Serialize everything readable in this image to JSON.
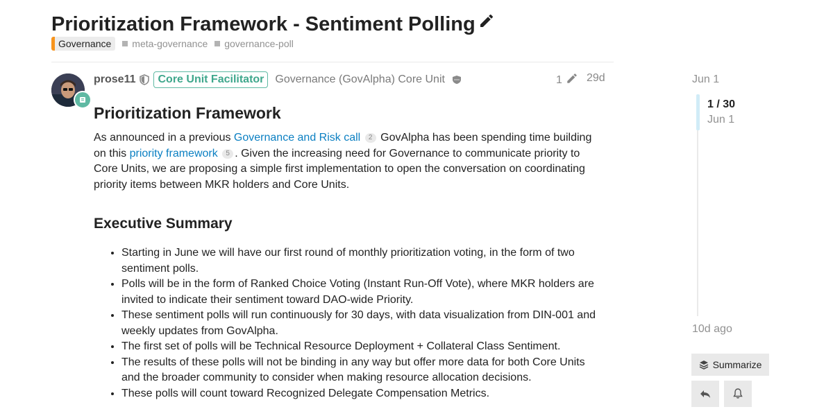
{
  "topic": {
    "title": "Prioritization Framework - Sentiment Polling",
    "category": {
      "name": "Governance",
      "color": "#f7941d"
    },
    "tags": [
      "meta-governance",
      "governance-poll"
    ]
  },
  "post": {
    "username": "prose11",
    "user_title": "Core Unit Facilitator",
    "organization": "Governance (GovAlpha) Core Unit",
    "edit_count": "1",
    "age": "29d",
    "heading": "Prioritization Framework",
    "intro": {
      "part1": "As announced in a previous ",
      "link1_text": "Governance and Risk call",
      "link1_count": "2",
      "part2": " GovAlpha has been spending time building on this ",
      "link2_text": "priority framework",
      "link2_count": "5",
      "part3": ". Given the increasing need for Governance to communicate priority to Core Units, we are proposing a simple first implementation to open the conversation on coordinating priority items between MKR holders and Core Units."
    },
    "section_heading": "Executive Summary",
    "bullets": [
      "Starting in June we will have our first round of monthly prioritization voting, in the form of two sentiment polls.",
      "Polls will be in the form of Ranked Choice Voting (Instant Run-Off Vote), where MKR holders are invited to indicate their sentiment toward DAO-wide Priority.",
      "These sentiment polls will run continuously for 30 days, with data visualization from DIN-001 and weekly updates from GovAlpha.",
      "The first set of polls will be Technical Resource Deployment + Collateral Class Sentiment.",
      "The results of these polls will not be binding in any way but offer more data for both Core Units and the broader community to consider when making resource allocation decisions.",
      "These polls will count toward Recognized Delegate Compensation Metrics."
    ]
  },
  "timeline": {
    "start_date": "Jun 1",
    "position": "1 / 30",
    "position_date": "Jun 1",
    "last_activity": "10d ago",
    "progress": 0.0333
  },
  "actions": {
    "summarize_label": "Summarize"
  },
  "icons": [
    "pencil-icon",
    "shield-icon",
    "group-icon",
    "layers-icon",
    "reply-icon",
    "bell-icon"
  ],
  "colors": {
    "link": "#0a7fc2",
    "accent": "#5fb9a3",
    "category": "#f7941d"
  }
}
